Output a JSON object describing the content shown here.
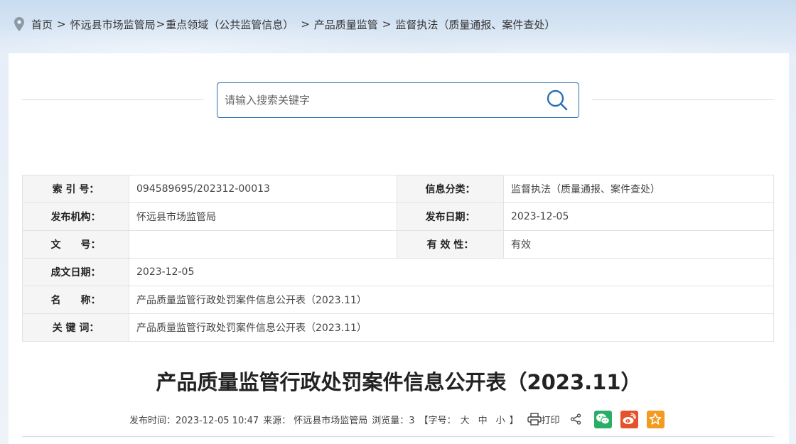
{
  "breadcrumb": {
    "items": [
      "首页",
      "怀远县市场监管局",
      "重点领域（公共监管信息）",
      "产品质量监管",
      "监督执法（质量通报、案件查处）"
    ],
    "sep": ">"
  },
  "search": {
    "placeholder": "请输入搜索关键字",
    "value": ""
  },
  "meta": {
    "index_label": "索 引 号：",
    "index_value": "094589695/202312-00013",
    "category_label": "信息分类：",
    "category_value": "监督执法（质量通报、案件查处）",
    "org_label": "发布机构：",
    "org_value": "怀远县市场监管局",
    "pubdate_label": "发布日期：",
    "pubdate_value": "2023-12-05",
    "docno_label": "文　　号：",
    "docno_value": "",
    "validity_label": "有 效 性：",
    "validity_value": "有效",
    "created_label": "成文日期：",
    "created_value": "2023-12-05",
    "name_label": "名　　称：",
    "name_value": "产品质量监管行政处罚案件信息公开表（2023.11）",
    "keywords_label": "关 键 词：",
    "keywords_value": "产品质量监管行政处罚案件信息公开表（2023.11）"
  },
  "article": {
    "title": "产品质量监管行政处罚案件信息公开表（2023.11）",
    "pubtime": "发布时间：2023-12-05 10:47",
    "source": "来源：  怀远县市场监管局",
    "views": "浏览量：3",
    "fontsize_label": "【字号：",
    "fontsize_large": "大",
    "fontsize_medium": "中",
    "fontsize_small": "小",
    "fontsize_end": "】",
    "print_label": "打印"
  },
  "colors": {
    "accent": "#2a6fb5",
    "wechat": "#2aae67",
    "weibo": "#e6522c",
    "favorite": "#f39b1f"
  },
  "icons": [
    "location-icon",
    "search-icon",
    "print-icon",
    "share-icon",
    "wechat-icon",
    "weibo-icon",
    "star-icon"
  ]
}
